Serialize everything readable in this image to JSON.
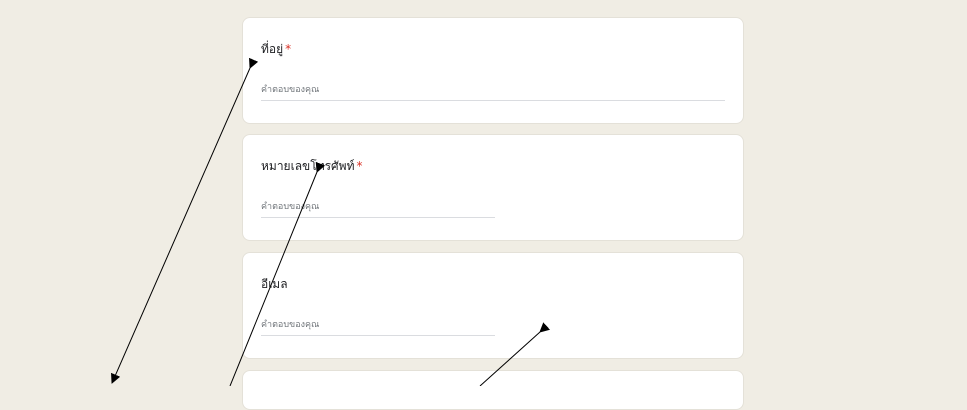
{
  "form": {
    "questions": [
      {
        "title": "ที่อยู่",
        "required_mark": "*",
        "placeholder": "คำตอบของคุณ"
      },
      {
        "title": "หมายเลขโทรศัพท์",
        "required_mark": "*",
        "placeholder": "คำตอบของคุณ"
      },
      {
        "title": "อีเมล",
        "required_mark": "",
        "placeholder": "คำตอบของคุณ"
      }
    ]
  },
  "colors": {
    "page_background": "#f0ede4",
    "card_background": "#ffffff",
    "required_mark": "#d93025",
    "annotation_arrow": "#000000"
  }
}
